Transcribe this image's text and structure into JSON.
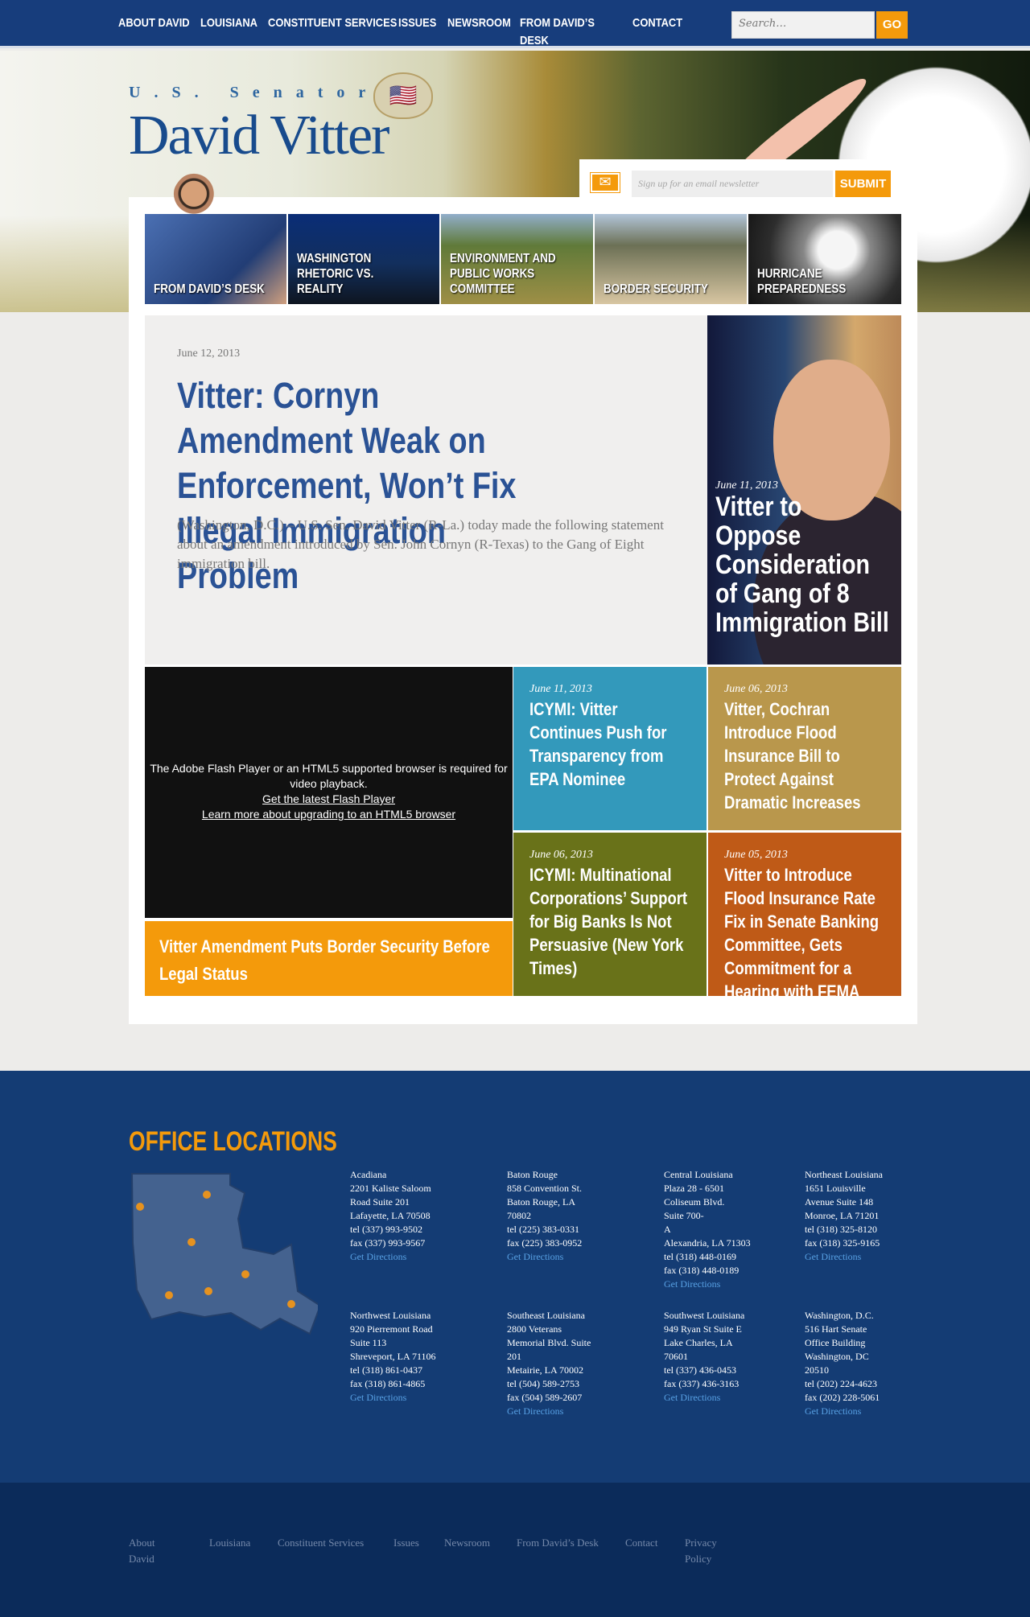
{
  "nav": {
    "items": [
      "About David",
      "Louisiana",
      "Constituent Services",
      "Issues",
      "Newsroom",
      "From David’s Desk",
      "Contact"
    ],
    "search_placeholder": "Search…",
    "go": "GO"
  },
  "header": {
    "title_small": "U.S. Senator",
    "title_large": "David Vitter",
    "seal": "🇺🇸"
  },
  "newsletter": {
    "placeholder": "Sign up for an email newsletter",
    "submit": "SUBMIT",
    "icon": "mail-icon"
  },
  "thumbs": [
    "From David’s Desk",
    "Washington Rhetoric vs. Reality",
    "Environment and Public Works Committee",
    "Border Security",
    "Hurricane Preparedness"
  ],
  "featured": {
    "date": "June 12, 2013",
    "headline": "Vitter: Cornyn Amendment Weak on Enforcement, Won’t Fix Illegal Immigration Problem",
    "summary": "(Washington, D.C.) – U.S. Sen. David Vitter (R-La.) today made the following statement about an amendment introduced by Sen. John Cornyn (R-Texas) to the Gang of Eight immigration bill."
  },
  "photo_story": {
    "date": "June 11, 2013",
    "headline": "Vitter to Oppose Consideration of Gang of 8 Immigration Bill"
  },
  "tiles": [
    {
      "date": "June 11, 2013",
      "headline": "ICYMI: Vitter Continues Push for Transparency from EPA Nominee",
      "color": "#3399bb"
    },
    {
      "date": "June 06, 2013",
      "headline": "Vitter, Cochran Introduce Flood Insurance Bill to Protect Against Dramatic Increases",
      "color": "#b9974c"
    },
    {
      "date": "June 06, 2013",
      "headline": "ICYMI: Multinational Corporations’ Support for Big Banks Is Not Persuasive (New York Times)",
      "color": "#697219"
    },
    {
      "date": "June 05, 2013",
      "headline": "Vitter to Introduce Flood Insurance Rate Fix in Senate Banking Committee, Gets Commitment for a Hearing with FEMA",
      "color": "#bf5a17"
    }
  ],
  "video": {
    "message": "The Adobe Flash Player or an HTML5 supported browser is required for video playback.",
    "link1": "Get the latest Flash Player",
    "link2": "Learn more about upgrading to an HTML5 browser"
  },
  "video_caption": "Vitter Amendment Puts Border Security Before Legal Status",
  "offices": {
    "heading": "OFFICE LOCATIONS",
    "list": [
      {
        "text": "Acadiana\n2201 Kaliste Saloom\nRoad Suite 201\nLafayette, LA 70508\ntel (337) 993-9502\nfax (337) 993-9567",
        "link": "Get Directions"
      },
      {
        "text": "Baton Rouge\n858 Convention St.\nBaton Rouge, LA\n70802\ntel (225) 383-0331\nfax (225) 383-0952",
        "link": "Get Directions"
      },
      {
        "text": "Central Louisiana\nPlaza 28 - 6501\nColiseum Blvd.\nSuite 700-\nA\nAlexandria, LA 71303\ntel (318) 448-0169\nfax (318) 448-0189",
        "link": "Get Directions"
      },
      {
        "text": "Northeast Louisiana\n1651 Louisville\nAvenue Suite 148\nMonroe, LA 71201\ntel (318) 325-8120\nfax (318) 325-9165",
        "link": "Get Directions"
      },
      {
        "text": "Northwest Louisiana\n920 Pierremont Road\nSuite 113\nShreveport, LA 71106\ntel (318) 861-0437\nfax (318) 861-4865",
        "link": "Get Directions"
      },
      {
        "text": "Southeast Louisiana\n2800 Veterans\nMemorial Blvd. Suite\n201\nMetairie, LA 70002\ntel (504) 589-2753\nfax (504) 589-2607",
        "link": "Get Directions"
      },
      {
        "text": "Southwest Louisiana\n949 Ryan St Suite E\nLake Charles, LA\n70601\ntel (337) 436-0453\nfax (337) 436-3163",
        "link": "Get Directions"
      },
      {
        "text": "Washington, D.C.\n516 Hart Senate\nOffice Building\nWashington, DC\n20510\ntel (202) 224-4623\nfax (202) 228-5061",
        "link": "Get Directions"
      }
    ]
  },
  "footer": {
    "links": [
      "About\nDavid",
      "Louisiana",
      "Constituent Services",
      "Issues",
      "Newsroom",
      "From David’s Desk",
      "Contact",
      "Privacy\nPolicy"
    ]
  }
}
